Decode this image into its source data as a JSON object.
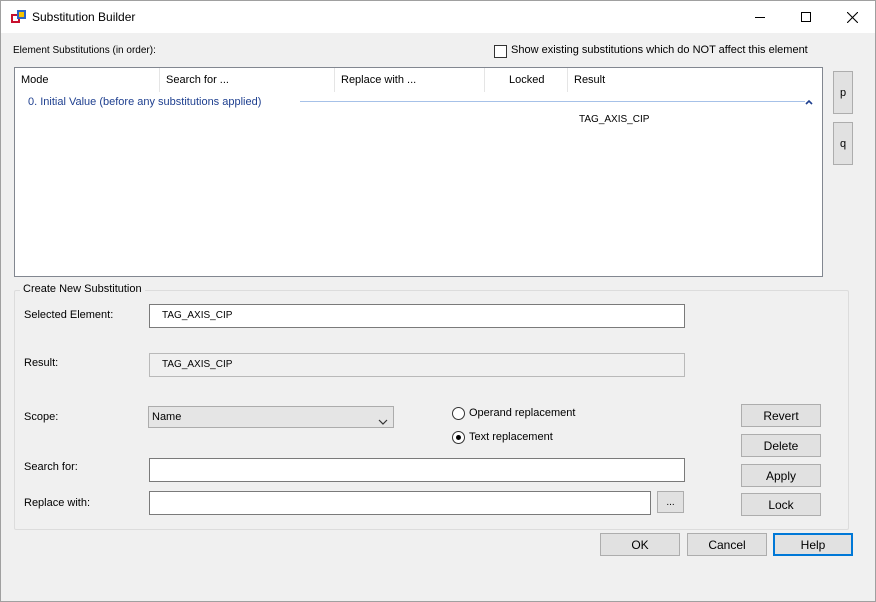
{
  "window": {
    "title": "Substitution Builder"
  },
  "list_section": {
    "label": "Element Substitutions (in order):",
    "show_existing_label": "Show existing substitutions which do NOT affect this element",
    "show_existing_checked": false,
    "columns": [
      "Mode",
      "Search for ...",
      "Replace with ...",
      "Locked",
      "Result"
    ],
    "group_header": "0. Initial Value (before any substitutions applied)",
    "group_result": "TAG_AXIS_CIP",
    "side_buttons": [
      "p",
      "q"
    ]
  },
  "create": {
    "group_title": "Create New Substitution",
    "selected_element_label": "Selected Element:",
    "selected_element_value": "TAG_AXIS_CIP",
    "result_label": "Result:",
    "result_value": "TAG_AXIS_CIP",
    "scope_label": "Scope:",
    "scope_value": "Name",
    "operand_replacement_label": "Operand replacement",
    "text_replacement_label": "Text replacement",
    "selected_mode": "Text replacement",
    "search_for_label": "Search for:",
    "search_for_value": "",
    "replace_with_label": "Replace with:",
    "replace_with_value": "",
    "browse_label": "...",
    "revert_label": "Revert",
    "delete_label": "Delete",
    "apply_label": "Apply",
    "lock_label": "Lock"
  },
  "footer": {
    "ok_label": "OK",
    "cancel_label": "Cancel",
    "help_label": "Help"
  },
  "colors": {
    "accent": "#0078d7",
    "group_text": "#1e3f8f",
    "group_line": "#a6c1e8",
    "window_bg": "#f0f0f0"
  }
}
